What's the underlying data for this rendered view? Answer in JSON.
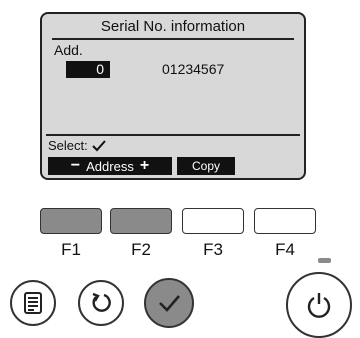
{
  "screen": {
    "title": "Serial No. information",
    "add_label": "Add.",
    "address_value": "0",
    "serial_number": "01234567",
    "select_label": "Select:"
  },
  "softkeys": {
    "minus": "−",
    "address_label": "Address",
    "plus": "+",
    "copy_label": "Copy"
  },
  "function_buttons": {
    "f1": "F1",
    "f2": "F2",
    "f3": "F3",
    "f4": "F4"
  },
  "icons": {
    "menu": "menu-icon",
    "return": "return-icon",
    "ok": "checkmark-icon",
    "power": "power-icon"
  },
  "colors": {
    "lcd_background": "#d8d8d8",
    "active_button": "#8a8a8a"
  }
}
